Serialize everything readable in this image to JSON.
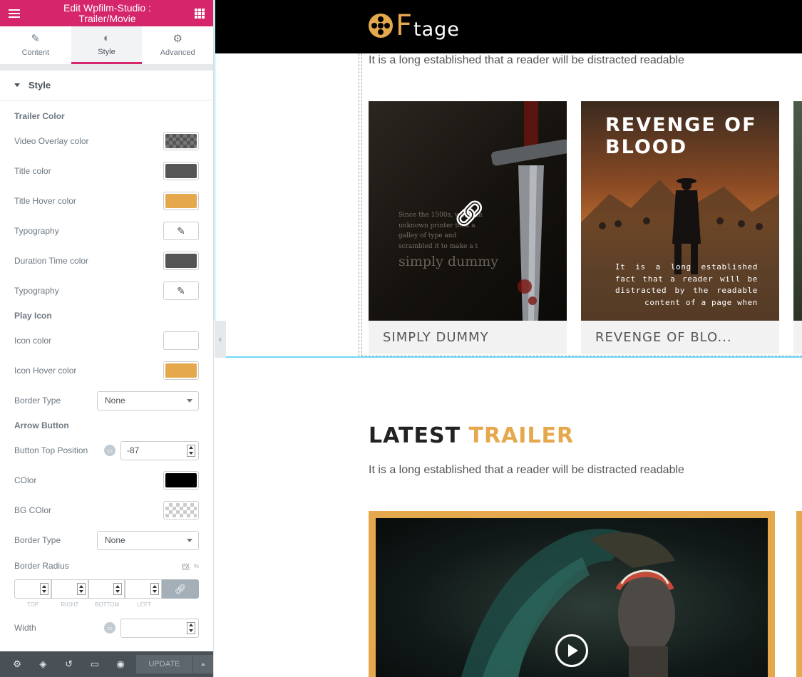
{
  "panel": {
    "title_line1": "Edit Wpfilm-Studio :",
    "title_line2": "Trailer/Movie",
    "tabs": [
      {
        "label": "Content",
        "icon": "pencil-icon"
      },
      {
        "label": "Style",
        "icon": "contrast-icon"
      },
      {
        "label": "Advanced",
        "icon": "gear-icon"
      }
    ],
    "section": "Style",
    "trailer_color_heading": "Trailer Color",
    "rows": {
      "video_overlay": "Video Overlay color",
      "title_color": "Title color",
      "title_hover": "Title Hover color",
      "typography1": "Typography",
      "duration_color": "Duration Time color",
      "typography2": "Typography"
    },
    "play_icon_heading": "Play Icon",
    "play_rows": {
      "icon_color": "Icon color",
      "icon_hover": "Icon Hover color",
      "border_type": "Border Type",
      "border_type_value": "None"
    },
    "arrow_heading": "Arrow Button",
    "arrow_rows": {
      "top_position": "Button Top Position",
      "top_position_value": "-87",
      "color": "COlor",
      "bg_color": "BG COlor",
      "border_type": "Border Type",
      "border_type_value": "None",
      "border_radius": "Border Radius",
      "unit_px": "PX",
      "unit_pct": "%",
      "dim_labels": [
        "TOP",
        "RIGHT",
        "BOTTOM",
        "LEFT"
      ],
      "width": "Width"
    },
    "footer": {
      "update_label": "UPDATE"
    },
    "colors": {
      "accent": "#d5256b",
      "title": "#555555",
      "hover": "#e6a84d",
      "duration": "#555555",
      "icon": "#ffffff",
      "icon_hover": "#e6a84d",
      "arrow": "#000000"
    }
  },
  "site": {
    "logo_f": "F",
    "logo_rest": "tage",
    "intro_text": "It is a long established that a reader will be distracted readable",
    "cards": [
      {
        "title": "SIMPLY DUMMY",
        "poster_text": "Since the 1500s, when an unknown printer took a galley of type and scrambled it to make a t",
        "poster_word": "simply dummy"
      },
      {
        "title": "REVENGE OF BLO...",
        "poster_title": "REVENGE OF BLOOD",
        "poster_tagline": "It is a long established fact that a reader will be distracted by the readable content of a page when"
      }
    ],
    "latest": {
      "title_dark": "LATEST",
      "title_gold": "TRAILER",
      "text": "It is a long established that a reader will be distracted readable"
    }
  }
}
